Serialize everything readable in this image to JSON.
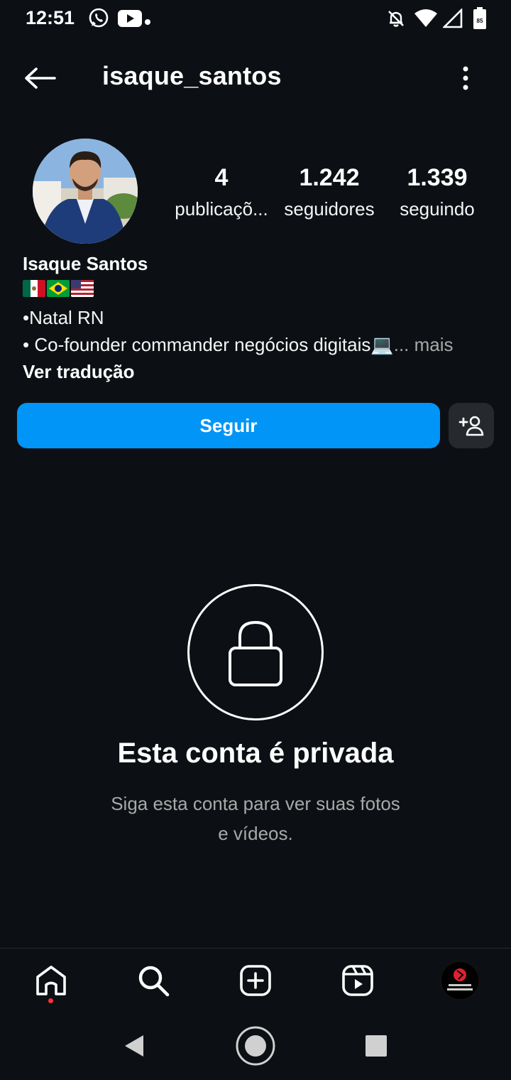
{
  "status_bar": {
    "time": "12:51",
    "battery": "85",
    "icons": [
      "whatsapp-icon",
      "youtube-icon",
      "notification-dot",
      "mute-bell-icon",
      "wifi-icon",
      "signal-icon",
      "battery-icon"
    ]
  },
  "header": {
    "username": "isaque_santos",
    "back_icon": "arrow-left-icon",
    "more_icon": "vertical-dots-icon"
  },
  "profile": {
    "stats": [
      {
        "value": "4",
        "label": "publicaçõ..."
      },
      {
        "value": "1.242",
        "label": "seguidores"
      },
      {
        "value": "1.339",
        "label": "seguindo"
      }
    ],
    "full_name": "Isaque Santos",
    "flags": [
      "mexico-flag",
      "brazil-flag",
      "usa-flag"
    ],
    "bio_line1": "•Natal RN",
    "bio_line2": "• Co-founder commander negócios digitais💻",
    "bio_more": "... mais",
    "translate": "Ver tradução"
  },
  "actions": {
    "follow_label": "Seguir",
    "suggest_icon": "add-person-icon"
  },
  "private": {
    "title": "Esta conta é privada",
    "subtitle_line1": "Siga esta conta para ver suas fotos",
    "subtitle_line2": "e vídeos."
  },
  "bottom_nav": {
    "items": [
      "home-icon",
      "search-icon",
      "create-icon",
      "reels-icon",
      "profile-avatar"
    ]
  },
  "colors": {
    "background": "#0c1014",
    "accent": "#0095f6",
    "secondary_text": "#a8a8a8",
    "button_dark": "#262a2f"
  }
}
